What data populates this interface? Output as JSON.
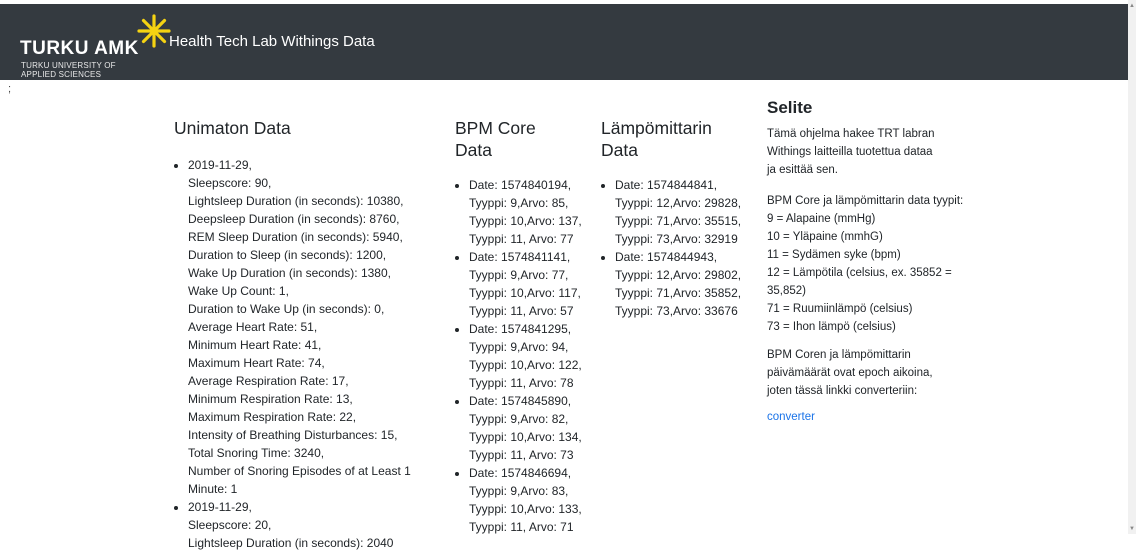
{
  "header": {
    "logo_main": "TURKU AMK",
    "logo_sub1": "TURKU UNIVERSITY OF",
    "logo_sub2": "APPLIED SCIENCES",
    "title": "Health Tech Lab Withings Data"
  },
  "stray_char": ";",
  "sleep": {
    "heading": "Unimaton Data",
    "items": [
      {
        "lines": [
          "2019-11-29,",
          "Sleepscore: 90,",
          "Lightsleep Duration (in seconds): 10380,",
          "Deepsleep Duration (in seconds): 8760,",
          "REM Sleep Duration (in seconds): 5940,",
          "Duration to Sleep (in seconds): 1200,",
          "Wake Up Duration (in seconds): 1380,",
          "Wake Up Count: 1,",
          "Duration to Wake Up (in seconds): 0,",
          "Average Heart Rate: 51,",
          "Minimum Heart Rate: 41,",
          "Maximum Heart Rate: 74,",
          "Average Respiration Rate: 17,",
          "Minimum Respiration Rate: 13,",
          "Maximum Respiration Rate: 22,",
          "Intensity of Breathing Disturbances: 15,",
          "Total Snoring Time: 3240,",
          "Number of Snoring Episodes of at Least 1",
          "Minute: 1"
        ]
      },
      {
        "lines": [
          "2019-11-29,",
          "Sleepscore: 20,",
          "Lightsleep Duration (in seconds): 2040"
        ]
      }
    ]
  },
  "bpm": {
    "heading": "BPM Core Data",
    "items": [
      {
        "lines": [
          "Date: 1574840194,",
          "Tyyppi: 9,Arvo: 85,",
          "Tyyppi: 10,Arvo: 137,",
          "Tyyppi: 11, Arvo: 77"
        ]
      },
      {
        "lines": [
          "Date: 1574841141,",
          "Tyyppi: 9,Arvo: 77,",
          "Tyyppi: 10,Arvo: 117,",
          "Tyyppi: 11, Arvo: 57"
        ]
      },
      {
        "lines": [
          "Date: 1574841295,",
          "Tyyppi: 9,Arvo: 94,",
          "Tyyppi: 10,Arvo: 122,",
          "Tyyppi: 11, Arvo: 78"
        ]
      },
      {
        "lines": [
          "Date: 1574845890,",
          "Tyyppi: 9,Arvo: 82,",
          "Tyyppi: 10,Arvo: 134,",
          "Tyyppi: 11, Arvo: 73"
        ]
      },
      {
        "lines": [
          "Date: 1574846694,",
          "Tyyppi: 9,Arvo: 83,",
          "Tyyppi: 10,Arvo: 133,",
          "Tyyppi: 11, Arvo: 71"
        ]
      }
    ]
  },
  "temp": {
    "heading": "Lämpömittarin Data",
    "items": [
      {
        "lines": [
          "Date: 1574844841,",
          "Tyyppi: 12,Arvo: 29828,",
          "Tyyppi: 71,Arvo: 35515,",
          "Tyyppi: 73,Arvo: 32919"
        ]
      },
      {
        "lines": [
          "Date: 1574844943,",
          "Tyyppi: 12,Arvo: 29802,",
          "Tyyppi: 71,Arvo: 35852,",
          "Tyyppi: 73,Arvo: 33676"
        ]
      }
    ]
  },
  "legend": {
    "heading": "Selite",
    "intro": [
      "Tämä ohjelma hakee TRT labran",
      "Withings laitteilla tuotettua dataa",
      "ja esittää sen."
    ],
    "types": [
      "BPM Core ja lämpömittarin data tyypit:",
      "9 = Alapaine (mmHg)",
      "10 = Yläpaine (mmhG)",
      "11 = Sydämen syke (bpm)",
      "12 = Lämpötila (celsius, ex. 35852 =",
      "35,852)",
      "71 = Ruumiinlämpö (celsius)",
      "73 = Ihon lämpö (celsius)"
    ],
    "epoch": [
      "BPM Coren ja lämpömittarin",
      "päivämäärät ovat epoch aikoina,",
      "joten tässä linkki converteriin:"
    ],
    "link_label": "converter"
  },
  "colors": {
    "navbar": "#343a40",
    "star": "#f5d312",
    "link": "#1a73e8"
  }
}
